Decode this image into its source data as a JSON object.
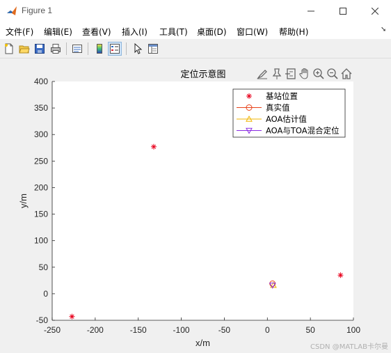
{
  "window": {
    "title": "Figure 1"
  },
  "menu": {
    "items": [
      {
        "label": "文件(F)"
      },
      {
        "label": "编辑(E)"
      },
      {
        "label": "查看(V)"
      },
      {
        "label": "插入(I)"
      },
      {
        "label": "工具(T)"
      },
      {
        "label": "桌面(D)"
      },
      {
        "label": "窗口(W)"
      },
      {
        "label": "帮助(H)"
      }
    ]
  },
  "toolbar": {
    "icons": [
      "new-figure-icon",
      "open-file-icon",
      "save-icon",
      "print-icon",
      "link-plot-icon",
      "colorbar-icon",
      "legend-icon",
      "pointer-icon",
      "property-editor-icon"
    ]
  },
  "axes_toolbar": {
    "icons": [
      "brush-icon",
      "data-tips-icon",
      "rotate-icon",
      "pan-icon",
      "zoom-in-icon",
      "zoom-out-icon",
      "home-icon"
    ]
  },
  "chart_data": {
    "type": "scatter",
    "title": "定位示意图",
    "xlabel": "x/m",
    "ylabel": "y/m",
    "xlim": [
      -250,
      100
    ],
    "ylim": [
      -50,
      400
    ],
    "xticks": [
      "-250",
      "-200",
      "-150",
      "-100",
      "-50",
      "0",
      "50",
      "100"
    ],
    "yticks": [
      "-50",
      "0",
      "50",
      "100",
      "150",
      "200",
      "250",
      "300",
      "350",
      "400"
    ],
    "grid": false,
    "legend_position": "top-right",
    "series": [
      {
        "name": "基站位置",
        "marker": "star",
        "color": "#e8001c",
        "points": [
          [
            -227,
            -43
          ],
          [
            -132,
            277
          ],
          [
            85,
            35
          ]
        ]
      },
      {
        "name": "真实值",
        "marker": "circle",
        "color": "#e8431a",
        "points": [
          [
            6,
            19
          ]
        ]
      },
      {
        "name": "AOA估计值",
        "marker": "triangle-up",
        "color": "#f0b400",
        "points": [
          [
            7,
            16
          ]
        ]
      },
      {
        "name": "AOA与TOA混合定位",
        "marker": "triangle-down",
        "color": "#8a2be2",
        "points": [
          [
            6,
            16
          ]
        ]
      }
    ]
  },
  "watermark": "CSDN @MATLAB卡尔曼"
}
